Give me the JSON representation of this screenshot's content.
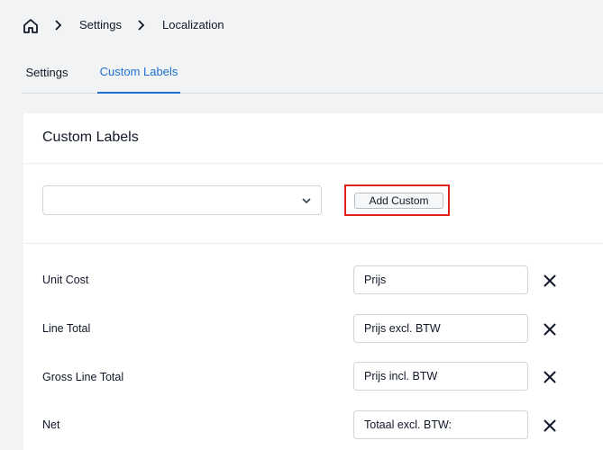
{
  "breadcrumb": {
    "home_icon": "home-icon",
    "items": [
      "Settings",
      "Localization"
    ]
  },
  "tabs": [
    {
      "label": "Settings",
      "active": false
    },
    {
      "label": "Custom Labels",
      "active": true
    }
  ],
  "card": {
    "title": "Custom Labels",
    "select_value": "",
    "add_button_label": "Add Custom",
    "highlight_color": "#e0201c"
  },
  "labels": [
    {
      "name": "Unit Cost",
      "value": "Prijs"
    },
    {
      "name": "Line Total",
      "value": "Prijs excl. BTW"
    },
    {
      "name": "Gross Line Total",
      "value": "Prijs incl. BTW"
    },
    {
      "name": "Net",
      "value": "Totaal excl. BTW:"
    }
  ],
  "colors": {
    "accent": "#1e6fd0",
    "background": "#f2f3f4"
  }
}
